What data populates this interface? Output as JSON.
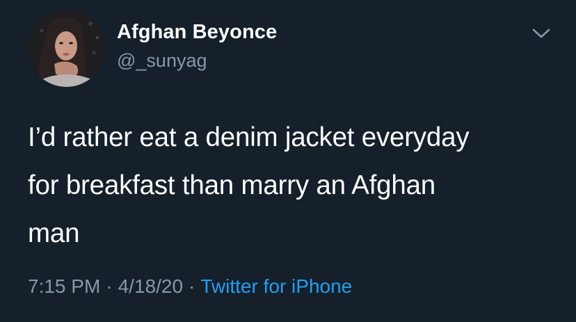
{
  "colors": {
    "background": "#15202b",
    "text_primary": "#ffffff",
    "text_secondary": "#8899a6",
    "accent": "#1da1f2"
  },
  "tweet": {
    "author": {
      "display_name": "Afghan Beyonce",
      "handle": "@_sunyag",
      "avatar_icon": "profile-photo"
    },
    "menu_icon": "chevron-down-icon",
    "text": "I’d rather eat a denim jacket everyday\nfor breakfast than marry an Afghan\nman",
    "time": "7:15 PM",
    "separator": "·",
    "date": "4/18/20",
    "source": "Twitter for iPhone"
  }
}
